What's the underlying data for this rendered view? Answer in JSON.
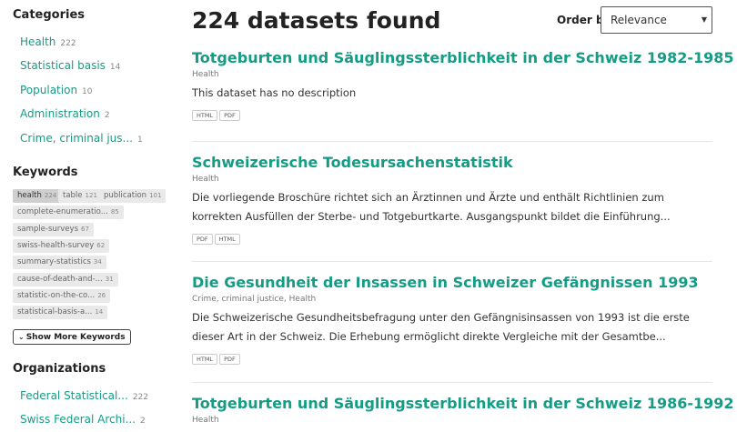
{
  "sidebar": {
    "categories_title": "Categories",
    "categories": [
      {
        "label": "Health",
        "count": "222"
      },
      {
        "label": "Statistical basis",
        "count": "14"
      },
      {
        "label": "Population",
        "count": "10"
      },
      {
        "label": "Administration",
        "count": "2"
      },
      {
        "label": "Crime, criminal jus...",
        "count": "1"
      }
    ],
    "keywords_title": "Keywords",
    "keywords": [
      {
        "label": "health",
        "count": "224"
      },
      {
        "label": "table",
        "count": "121"
      },
      {
        "label": "publication",
        "count": "101"
      },
      {
        "label": "complete-enumeratio...",
        "count": "85"
      },
      {
        "label": "sample-surveys",
        "count": "67"
      },
      {
        "label": "swiss-health-survey",
        "count": "62"
      },
      {
        "label": "summary-statistics",
        "count": "34"
      },
      {
        "label": "cause-of-death-and-...",
        "count": "31"
      },
      {
        "label": "statistic-on-the-co...",
        "count": "26"
      },
      {
        "label": "statistical-basis-a...",
        "count": "14"
      }
    ],
    "show_more_label": "Show More Keywords",
    "organizations_title": "Organizations",
    "organizations": [
      {
        "label": "Federal Statistical...",
        "count": "222"
      },
      {
        "label": "Swiss Federal Archi...",
        "count": "2"
      }
    ]
  },
  "main": {
    "results_title": "224 datasets found",
    "order_label": "Order by",
    "order_value": "Relevance",
    "datasets": [
      {
        "title": "Totgeburten und Säuglingssterblichkeit in der Schweiz 1982-1985",
        "groups": "Health",
        "description": "This dataset has no description",
        "formats": [
          "HTML",
          "PDF"
        ]
      },
      {
        "title": "Schweizerische Todesursachenstatistik",
        "groups": "Health",
        "description": "Die vorliegende Broschüre richtet sich an Ärztinnen und Ärzte und enthält Richtlinien zum korrekten Ausfüllen der Sterbe- und Totgeburtkarte. Ausgangspunkt bildet die Einführung...",
        "formats": [
          "PDF",
          "HTML"
        ]
      },
      {
        "title": "Die Gesundheit der Insassen in Schweizer Gefängnissen 1993",
        "groups": "Crime, criminal justice, Health",
        "description": "Die Schweizerische Gesundheitsbefragung unter den Gefängnisinsassen von 1993 ist die erste dieser Art in der Schweiz. Die Erhebung ermöglicht direkte Vergleiche mit der Gesamtbe...",
        "formats": [
          "HTML",
          "PDF"
        ]
      },
      {
        "title": "Totgeburten und Säuglingssterblichkeit in der Schweiz 1986-1992",
        "groups": "Health",
        "description": "",
        "formats": []
      }
    ]
  },
  "colors": {
    "accent": "#149c85",
    "tag_bg": "#e9e9e9",
    "tag_active_bg": "#cfcfcf"
  },
  "icons": {
    "select_arrow": "caret-down-icon",
    "show_more": "chevron-down-icon"
  }
}
